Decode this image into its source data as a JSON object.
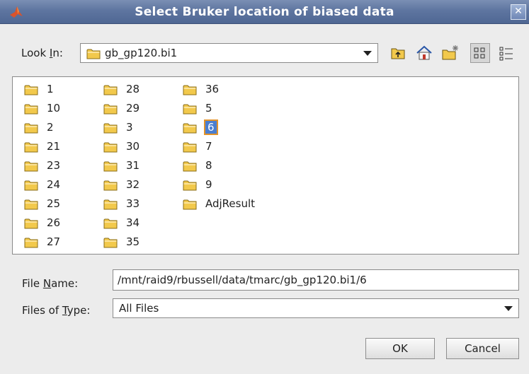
{
  "window": {
    "title": "Select Bruker location of biased data",
    "close_glyph": "✕"
  },
  "look_in": {
    "label_pre": "Look ",
    "label_mnemonic": "I",
    "label_post": "n:",
    "value": "gb_gp120.bi1"
  },
  "toolbar": {
    "icons": [
      "up-one-level-icon",
      "home-icon",
      "new-folder-icon",
      "list-view-icon",
      "details-view-icon"
    ]
  },
  "files": {
    "columns": [
      [
        "1",
        "10",
        "2",
        "21",
        "23",
        "24",
        "25",
        "26",
        "27"
      ],
      [
        "28",
        "29",
        "3",
        "30",
        "31",
        "32",
        "33",
        "34",
        "35"
      ],
      [
        "36",
        "5",
        "6",
        "7",
        "8",
        "9",
        "AdjResult"
      ]
    ],
    "selected": "6"
  },
  "file_name": {
    "label_pre": "File ",
    "label_mnemonic": "N",
    "label_post": "ame:",
    "value": "/mnt/raid9/rbussell/data/tmarc/gb_gp120.bi1/6"
  },
  "files_of_type": {
    "label_pre": "Files of ",
    "label_mnemonic": "T",
    "label_post": "ype:",
    "value": "All Files"
  },
  "buttons": {
    "ok": "OK",
    "cancel": "Cancel"
  },
  "colors": {
    "titlebar": "#5e75a0",
    "selection": "#4a7ed0",
    "selection_border": "#e2932a",
    "folder": "#e8b93a"
  }
}
